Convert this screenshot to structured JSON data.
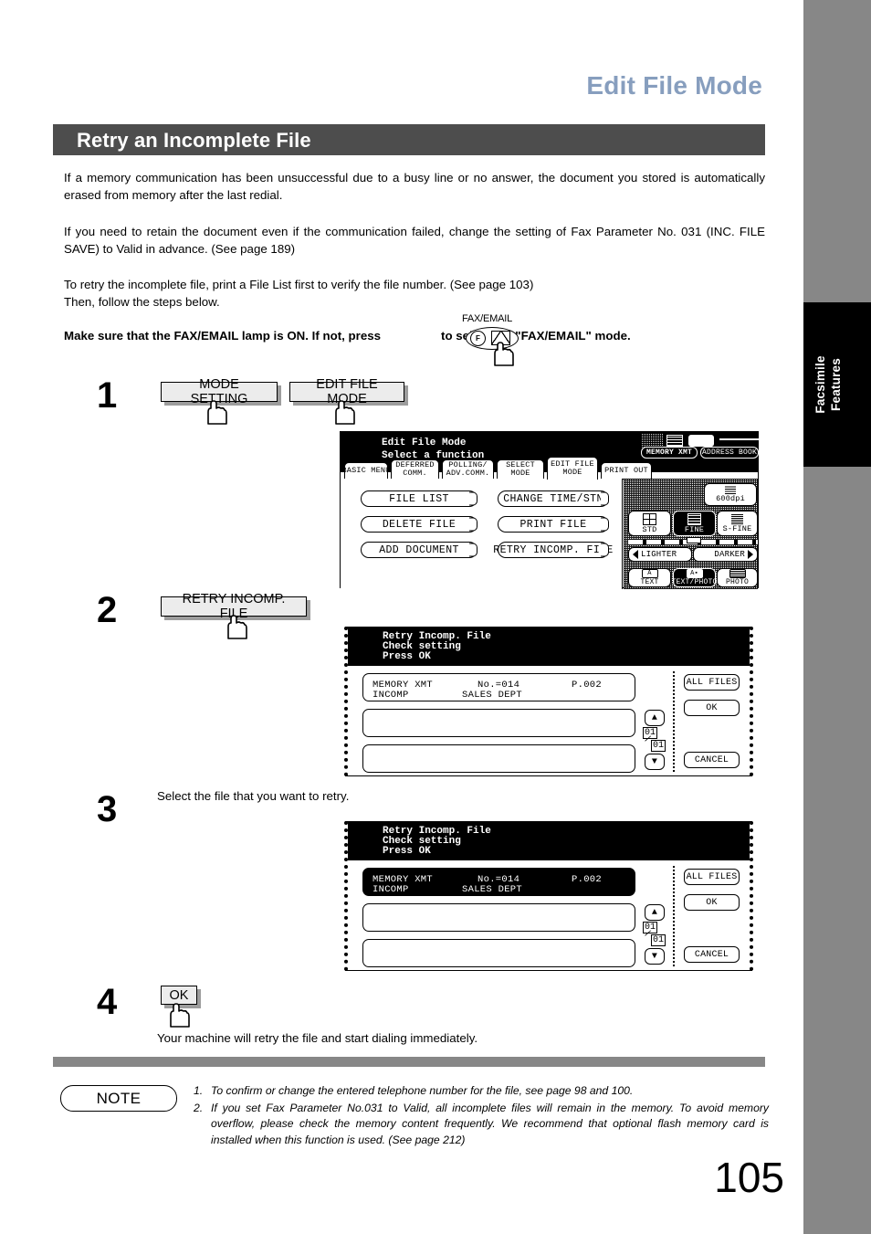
{
  "chapter": {
    "title": "Edit File Mode"
  },
  "sidebar": {
    "tab_label": "Facsimile\nFeatures"
  },
  "section": {
    "title": "Retry an Incomplete File"
  },
  "intro": {
    "p1": "If a memory communication has been unsuccessful due to a busy line or no answer, the document you stored is automatically erased from memory after the last redial.",
    "p2": "If you need to retain the document even if the communication failed, change the setting of Fax Parameter No. 031 (INC. FILE SAVE) to Valid in advance.  (See page 189)",
    "p3": "To retry the incomplete file, print a File List first to verify the file number.  (See page 103)\nThen, follow the steps below.",
    "make_sure_prefix": "Make sure that the FAX/EMAIL lamp is ON.  If not, press",
    "make_sure_suffix": "to select the \"FAX/EMAIL\" mode.",
    "fax_email_label": "FAX/EMAIL"
  },
  "steps": {
    "s1": {
      "number": "1",
      "buttons": [
        "MODE SETTING",
        "EDIT FILE MODE"
      ]
    },
    "s2": {
      "number": "2",
      "buttons": [
        "RETRY INCOMP. FILE"
      ]
    },
    "s3": {
      "number": "3",
      "instruction": "Select the file that you want to retry."
    },
    "s4": {
      "number": "4",
      "buttons": [
        "OK"
      ],
      "instruction": "Your machine will retry the file and start dialing immediately."
    }
  },
  "lcd1": {
    "header_line1": "Edit File Mode",
    "header_line2": "Select a function",
    "tabs": [
      {
        "label": "BASIC MENU",
        "active": false
      },
      {
        "label": "DEFERRED\nCOMM.",
        "active": false
      },
      {
        "label": "POLLING/\nADV.COMM.",
        "active": false
      },
      {
        "label": "SELECT\nMODE",
        "active": false
      },
      {
        "label": "EDIT FILE\nMODE",
        "active": true
      },
      {
        "label": "PRINT OUT",
        "active": false
      }
    ],
    "functions_left": [
      "FILE LIST",
      "DELETE FILE",
      "ADD DOCUMENT"
    ],
    "functions_right": [
      "CHANGE TIME/STN",
      "PRINT FILE",
      "RETRY INCOMP. FILE"
    ],
    "status": {
      "mode_badge": "MEMORY XMT",
      "address_book": "ADDRESS BOOK",
      "resolution_dpi": "600dpi",
      "resolutions": [
        {
          "label": "STD",
          "active": false
        },
        {
          "label": "FINE",
          "active": true
        },
        {
          "label": "S-FINE",
          "active": false
        }
      ],
      "contrast_lighter": "LIGHTER",
      "contrast_darker": "DARKER",
      "originals": [
        {
          "label": "TEXT",
          "active": false
        },
        {
          "label": "TEXT/PHOTO",
          "active": true
        },
        {
          "label": "PHOTO",
          "active": false
        }
      ]
    }
  },
  "lcd2": {
    "header_line1": "Retry Incomp. File",
    "header_line2": "Check setting",
    "header_line3": "Press OK",
    "file_rows": [
      {
        "type": "MEMORY XMT",
        "no": "No.=014",
        "pages": "P.002",
        "status": "INCOMP",
        "station": "SALES DEPT",
        "selected": false
      },
      {
        "type": "",
        "no": "",
        "pages": "",
        "status": "",
        "station": "",
        "selected": false
      },
      {
        "type": "",
        "no": "",
        "pages": "",
        "status": "",
        "station": "",
        "selected": false
      }
    ],
    "scroll": {
      "up": "▲",
      "down": "▼",
      "current": "01",
      "total": "01"
    },
    "buttons": [
      "ALL FILES",
      "OK",
      "CANCEL"
    ]
  },
  "lcd3": {
    "header_line1": "Retry Incomp. File",
    "header_line2": "Check setting",
    "header_line3": "Press OK",
    "file_rows": [
      {
        "type": "MEMORY XMT",
        "no": "No.=014",
        "pages": "P.002",
        "status": "INCOMP",
        "station": "SALES DEPT",
        "selected": true
      },
      {
        "type": "",
        "no": "",
        "pages": "",
        "status": "",
        "station": "",
        "selected": false
      },
      {
        "type": "",
        "no": "",
        "pages": "",
        "status": "",
        "station": "",
        "selected": false
      }
    ],
    "scroll": {
      "up": "▲",
      "down": "▼",
      "current": "01",
      "total": "01"
    },
    "buttons": [
      "ALL FILES",
      "OK",
      "CANCEL"
    ]
  },
  "note": {
    "label": "NOTE",
    "items": [
      {
        "num": "1.",
        "text": "To confirm or change the entered telephone number for the file, see  page 98 and 100."
      },
      {
        "num": "2.",
        "text": "If you set Fax Parameter No.031 to Valid, all incomplete files will remain in the memory.  To avoid memory overflow, please check the memory content frequently.  We recommend that optional flash memory card is installed when this function is used.  (See page 212)"
      }
    ]
  },
  "footer": {
    "page_number": "105"
  },
  "colors": {
    "accent_title": "#879ebe",
    "section_bar": "#4d4d4d",
    "rail": "#878787"
  }
}
